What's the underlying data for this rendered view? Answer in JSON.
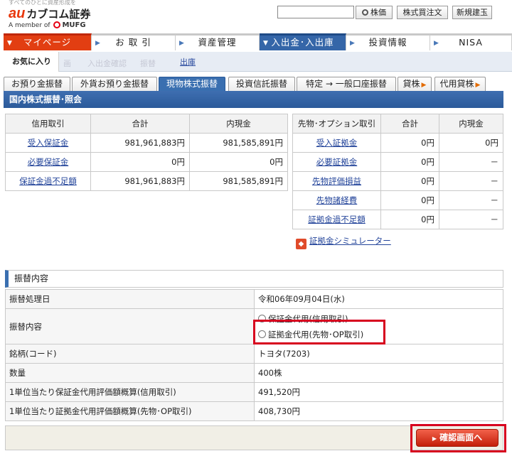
{
  "header": {
    "tagline": "すべてのひとに資産形成を",
    "logo_au": "au",
    "logo_name": "カブコム証券",
    "mufg_prefix": "A member of",
    "mufg_name": "MUFG",
    "search_button": "株価",
    "buy_button": "株式買注文",
    "new_button": "新規建玉"
  },
  "nav": {
    "items": [
      {
        "label": "マイページ"
      },
      {
        "label": "お 取 引"
      },
      {
        "label": "資産管理"
      },
      {
        "label": "入出金･入出庫"
      },
      {
        "label": "投資情報"
      },
      {
        "label": "NISA"
      }
    ]
  },
  "favbar": {
    "tab": "お気に入り",
    "ghost_1": "画",
    "ghost_2": "入出金確認",
    "ghost_3": "振替",
    "link": "出庫"
  },
  "subtabs": [
    {
      "label": "お預り金振替"
    },
    {
      "label": "外貨お預り金振替"
    },
    {
      "label": "現物株式振替"
    },
    {
      "label": "投資信託振替"
    },
    {
      "label": "特定 → 一般口座振替"
    },
    {
      "label": "貸株"
    },
    {
      "label": "代用貸株"
    }
  ],
  "section_title": "国内株式振替･照会",
  "margin_table": {
    "headers": [
      "信用取引",
      "合計",
      "内現金"
    ],
    "rows": [
      {
        "label": "受入保証金",
        "total": "981,961,883円",
        "cash": "981,585,891円"
      },
      {
        "label": "必要保証金",
        "total": "0円",
        "cash": "0円"
      },
      {
        "label": "保証金過不足額",
        "total": "981,961,883円",
        "cash": "981,585,891円"
      }
    ]
  },
  "futures_table": {
    "headers": [
      "先物･オプション取引",
      "合計",
      "内現金"
    ],
    "rows": [
      {
        "label": "受入証拠金",
        "total": "0円",
        "cash": "0円"
      },
      {
        "label": "必要証拠金",
        "total": "0円",
        "cash": "－"
      },
      {
        "label": "先物評価損益",
        "total": "0円",
        "cash": "－"
      },
      {
        "label": "先物諸経費",
        "total": "0円",
        "cash": "－"
      },
      {
        "label": "証拠金過不足額",
        "total": "0円",
        "cash": "－"
      }
    ]
  },
  "simulator_link": "証拠金シミュレーター",
  "transfer": {
    "title": "振替内容",
    "date_label": "振替処理日",
    "date_value": "令和06年09月04日(水)",
    "content_label": "振替内容",
    "option_margin": "保証金代用(信用取引)",
    "option_futures": "証拠金代用(先物･OP取引)",
    "stock_label": "銘柄(コード)",
    "stock_value": "トヨタ(7203)",
    "qty_label": "数量",
    "qty_value": "400株",
    "margin_eval_label": "1単位当たり保証金代用評価額概算(信用取引)",
    "margin_eval_value": "491,520円",
    "futures_eval_label": "1単位当たり証拠金代用評価額概算(先物･OP取引)",
    "futures_eval_value": "408,730円"
  },
  "confirm_button": "確認画面へ"
}
